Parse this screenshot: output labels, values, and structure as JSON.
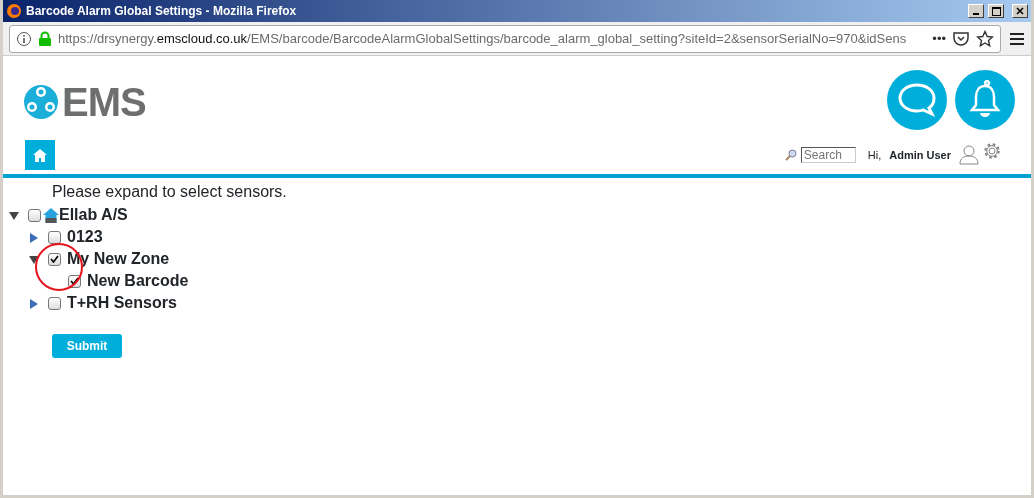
{
  "window": {
    "title": "Barcode Alarm Global Settings - Mozilla Firefox"
  },
  "address_bar": {
    "url_prefix": "https://drsynergy.",
    "url_domain": "emscloud.co.uk",
    "url_rest": "/EMS/barcode/BarcodeAlarmGlobalSettings/barcode_alarm_global_setting?siteId=2&sensorSerialNo=970&idSens",
    "more": "•••"
  },
  "logo": {
    "text": "EMS"
  },
  "header": {
    "search": {
      "placeholder": "Search"
    },
    "greeting": "Hi,",
    "user": "Admin User"
  },
  "instruction": "Please expand to select sensors.",
  "tree": [
    {
      "label": "Ellab A/S",
      "kind": "site",
      "expanded": true,
      "checked": false,
      "children": [
        {
          "label": "0123",
          "kind": "zone",
          "expanded": false,
          "checked": false
        },
        {
          "label": "My New Zone",
          "kind": "zone",
          "expanded": true,
          "checked": true,
          "children": [
            {
              "label": "New Barcode",
              "kind": "sensor",
              "checked": true
            }
          ]
        },
        {
          "label": "T+RH Sensors",
          "kind": "zone",
          "expanded": false,
          "checked": false
        }
      ]
    }
  ],
  "submit_button": "Submit"
}
